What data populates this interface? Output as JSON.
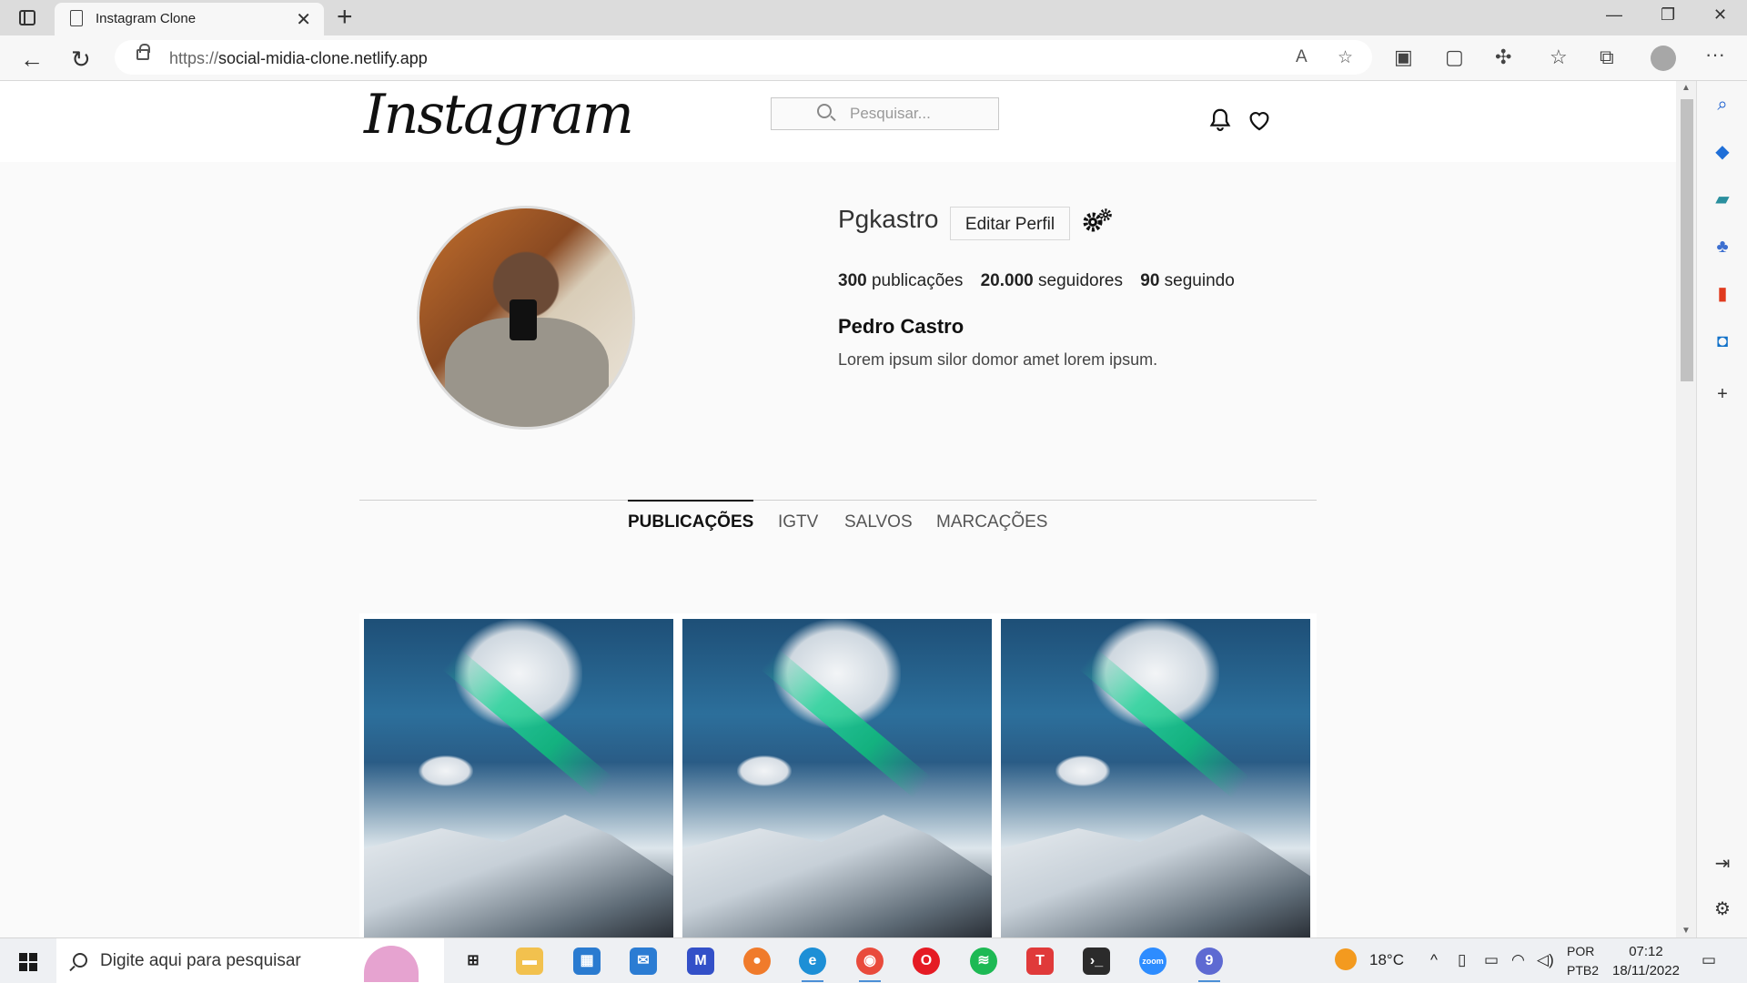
{
  "browser": {
    "tab_title": "Instagram Clone",
    "url_proto": "https://",
    "url_host": "social-midia-clone.netlify.app"
  },
  "header": {
    "logo": "Instagram",
    "search_placeholder": "Pesquisar..."
  },
  "profile": {
    "username": "Pgkastro",
    "edit_button": "Editar Perfil",
    "stats": [
      {
        "count": "300",
        "label": "publicações"
      },
      {
        "count": "20.000",
        "label": "seguidores"
      },
      {
        "count": "90",
        "label": "seguindo"
      }
    ],
    "full_name": "Pedro Castro",
    "bio": "Lorem ipsum silor domor amet lorem ipsum."
  },
  "tabs": [
    {
      "label": "PUBLICAÇÕES",
      "active": true
    },
    {
      "label": "IGTV",
      "active": false
    },
    {
      "label": "SALVOS",
      "active": false
    },
    {
      "label": "MARCAÇÕES",
      "active": false
    }
  ],
  "posts_count_visible": 3,
  "taskbar": {
    "search_text": "Digite aqui para pesquisar",
    "weather": "18°C",
    "lang_top": "POR",
    "lang_bottom": "PTB2",
    "time": "07:12",
    "date": "18/11/2022"
  }
}
